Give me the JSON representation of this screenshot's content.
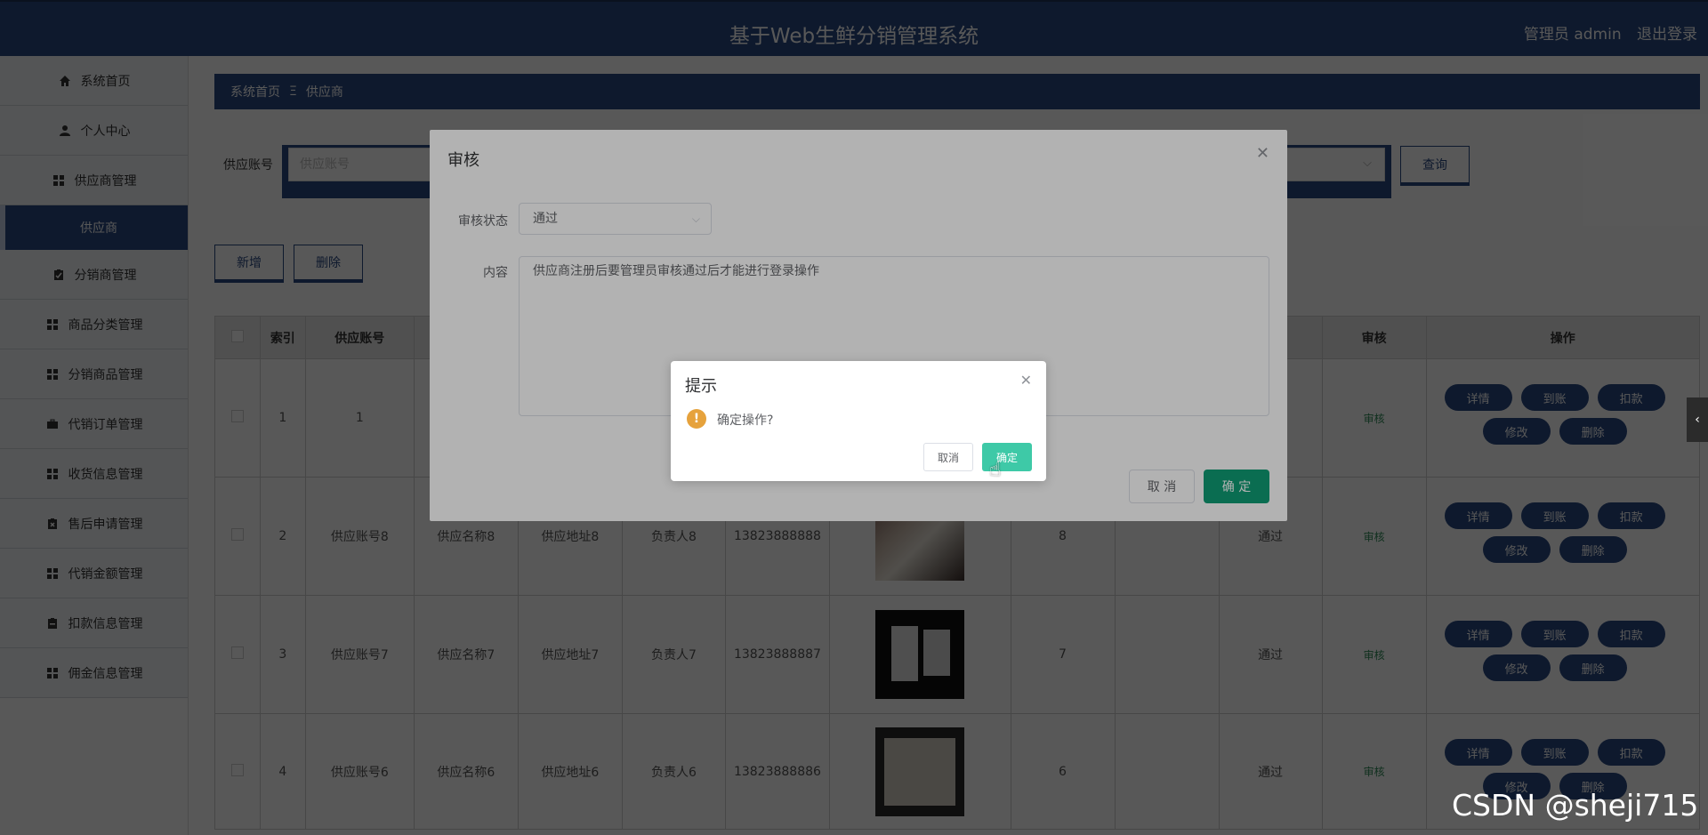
{
  "header": {
    "title": "基于Web生鲜分销管理系统",
    "user": "管理员 admin",
    "logout": "退出登录"
  },
  "sidebar": {
    "items": [
      {
        "label": "系统首页",
        "icon": "home-icon"
      },
      {
        "label": "个人中心",
        "icon": "user-icon"
      },
      {
        "label": "供应商管理",
        "icon": "grid-icon"
      }
    ],
    "sub_active": "供应商",
    "items2": [
      {
        "label": "分销商管理",
        "icon": "clipboard-icon"
      },
      {
        "label": "商品分类管理",
        "icon": "grid-icon"
      },
      {
        "label": "分销商品管理",
        "icon": "grid-icon"
      },
      {
        "label": "代销订单管理",
        "icon": "briefcase-icon"
      },
      {
        "label": "收货信息管理",
        "icon": "grid-icon"
      },
      {
        "label": "售后申请管理",
        "icon": "clipboard-x-icon"
      },
      {
        "label": "代销金额管理",
        "icon": "grid-icon"
      },
      {
        "label": "扣款信息管理",
        "icon": "clipboard-icon"
      },
      {
        "label": "佣金信息管理",
        "icon": "grid-icon"
      }
    ]
  },
  "breadcrumb": {
    "home": "系统首页",
    "sep": "Ξ",
    "current": "供应商"
  },
  "search": {
    "label": "供应账号",
    "placeholder": "供应账号",
    "query": "查询"
  },
  "actions": {
    "add": "新增",
    "delete": "删除"
  },
  "table": {
    "headers": {
      "index": "索引",
      "account": "供应账号",
      "audit": "审核",
      "ops": "操作"
    },
    "rows": [
      {
        "index": "1",
        "account": "1",
        "name": "",
        "address": "",
        "contact": "",
        "phone": "",
        "num": "",
        "status": "",
        "audit": "审核"
      },
      {
        "index": "2",
        "account": "供应账号8",
        "name": "供应名称8",
        "address": "供应地址8",
        "contact": "负责人8",
        "phone": "13823888888",
        "num": "8",
        "status": "通过",
        "audit": "审核"
      },
      {
        "index": "3",
        "account": "供应账号7",
        "name": "供应名称7",
        "address": "供应地址7",
        "contact": "负责人7",
        "phone": "13823888887",
        "num": "7",
        "status": "通过",
        "audit": "审核"
      },
      {
        "index": "4",
        "account": "供应账号6",
        "name": "供应名称6",
        "address": "供应地址6",
        "contact": "负责人6",
        "phone": "13823888886",
        "num": "6",
        "status": "通过",
        "audit": "审核"
      }
    ],
    "op_labels": {
      "detail": "详情",
      "arrive": "到账",
      "deduct": "扣款",
      "edit": "修改",
      "remove": "删除"
    }
  },
  "dialog": {
    "title": "审核",
    "status_label": "审核状态",
    "status_value": "通过",
    "content_label": "内容",
    "content_value": "供应商注册后要管理员审核通过后才能进行登录操作",
    "cancel": "取 消",
    "ok": "确 定"
  },
  "msgbox": {
    "title": "提示",
    "text": "确定操作?",
    "cancel": "取消",
    "ok": "确定",
    "icon": "!"
  },
  "toggle": "‹",
  "watermark": "CSDN @sheji715"
}
